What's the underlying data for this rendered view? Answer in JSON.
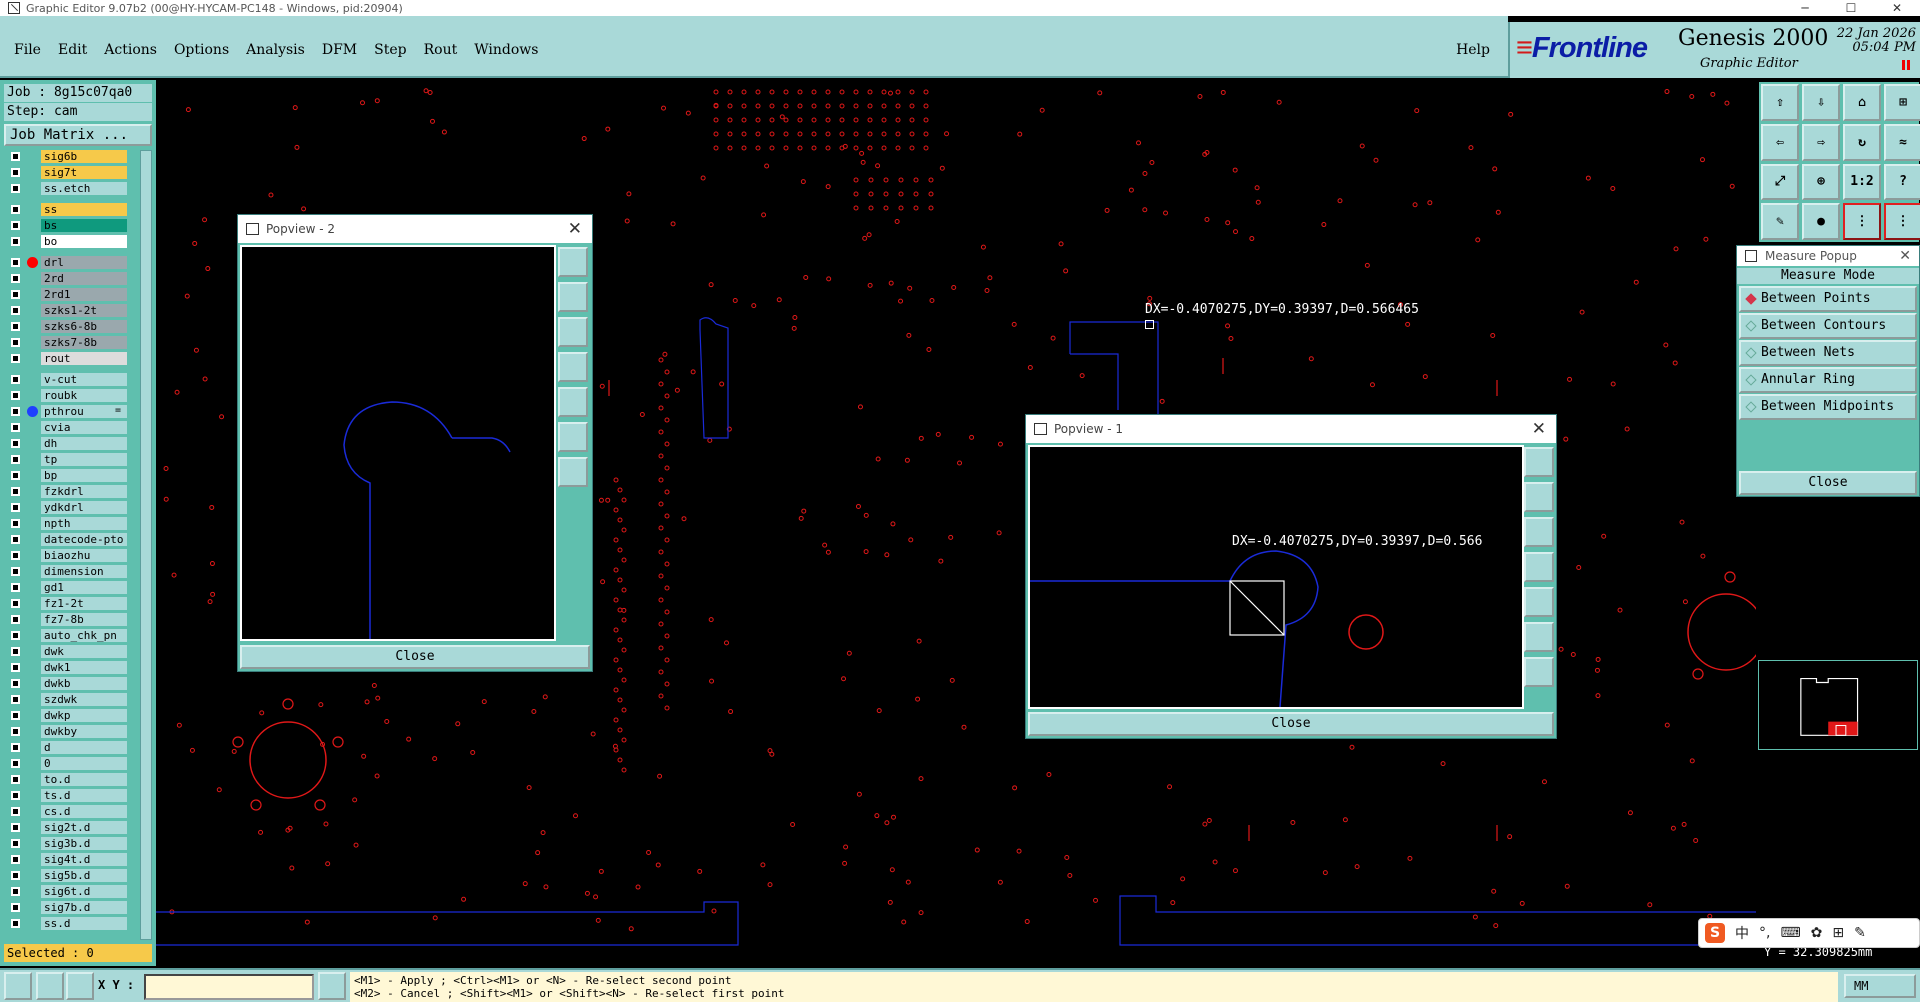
{
  "window": {
    "title": "Graphic Editor 9.07b2 (00@HY-HYCAM-PC148 - Windows, pid:20904)"
  },
  "menu": {
    "items": [
      "File",
      "Edit",
      "Actions",
      "Options",
      "Analysis",
      "DFM",
      "Step",
      "Rout",
      "Windows"
    ],
    "help": "Help"
  },
  "brand": {
    "logo": "Frontline",
    "product": "Genesis 2000",
    "subtitle": "Graphic Editor",
    "date": "22 Jan 2026",
    "time": "05:04 PM"
  },
  "job": {
    "job_label": "Job : 8g15c07qa0",
    "step_label": "Step: cam",
    "matrix_button": "Job Matrix ..."
  },
  "layers": [
    {
      "name": "sig6b",
      "color": "#f6c94a"
    },
    {
      "name": "sig7t",
      "color": "#f6c94a"
    },
    {
      "name": "ss.etch",
      "color": "#a9d9d8"
    },
    {
      "name": "ss",
      "color": "#f6c94a"
    },
    {
      "name": "bs",
      "color": "#0f9a7e"
    },
    {
      "name": "bo",
      "color": "#ffffff"
    },
    {
      "name": "drl",
      "color": "#9aa8ad",
      "active": "#ff0000"
    },
    {
      "name": "2rd",
      "color": "#9aa8ad"
    },
    {
      "name": "2rd1",
      "color": "#9aa8ad"
    },
    {
      "name": "szks1-2t",
      "color": "#9aa8ad"
    },
    {
      "name": "szks6-8b",
      "color": "#9aa8ad"
    },
    {
      "name": "szks7-8b",
      "color": "#9aa8ad"
    },
    {
      "name": "rout",
      "color": "#dcdcdc"
    },
    {
      "name": "v-cut",
      "color": "#a9d9d8"
    },
    {
      "name": "roubk",
      "color": "#a9d9d8"
    },
    {
      "name": "pthrou",
      "color": "#a9d9d8",
      "active": "#1f3fff",
      "mark": "="
    },
    {
      "name": "cvia",
      "color": "#a9d9d8"
    },
    {
      "name": "dh",
      "color": "#a9d9d8"
    },
    {
      "name": "tp",
      "color": "#a9d9d8"
    },
    {
      "name": "bp",
      "color": "#a9d9d8"
    },
    {
      "name": "fzkdrl",
      "color": "#a9d9d8"
    },
    {
      "name": "ydkdrl",
      "color": "#a9d9d8"
    },
    {
      "name": "npth",
      "color": "#a9d9d8"
    },
    {
      "name": "datecode-pto",
      "color": "#a9d9d8"
    },
    {
      "name": "biaozhu",
      "color": "#a9d9d8"
    },
    {
      "name": "dimension",
      "color": "#a9d9d8"
    },
    {
      "name": "gd1",
      "color": "#a9d9d8"
    },
    {
      "name": "fz1-2t",
      "color": "#a9d9d8"
    },
    {
      "name": "fz7-8b",
      "color": "#a9d9d8"
    },
    {
      "name": "auto_chk_pn",
      "color": "#a9d9d8"
    },
    {
      "name": "dwk",
      "color": "#a9d9d8"
    },
    {
      "name": "dwk1",
      "color": "#a9d9d8"
    },
    {
      "name": "dwkb",
      "color": "#a9d9d8"
    },
    {
      "name": "szdwk",
      "color": "#a9d9d8"
    },
    {
      "name": "dwkp",
      "color": "#a9d9d8"
    },
    {
      "name": "dwkby",
      "color": "#a9d9d8"
    },
    {
      "name": "d",
      "color": "#a9d9d8"
    },
    {
      "name": "0",
      "color": "#a9d9d8"
    },
    {
      "name": "to.d",
      "color": "#a9d9d8"
    },
    {
      "name": "ts.d",
      "color": "#a9d9d8"
    },
    {
      "name": "cs.d",
      "color": "#a9d9d8"
    },
    {
      "name": "sig2t.d",
      "color": "#a9d9d8"
    },
    {
      "name": "sig3b.d",
      "color": "#a9d9d8"
    },
    {
      "name": "sig4t.d",
      "color": "#a9d9d8"
    },
    {
      "name": "sig5b.d",
      "color": "#a9d9d8"
    },
    {
      "name": "sig6t.d",
      "color": "#a9d9d8"
    },
    {
      "name": "sig7b.d",
      "color": "#a9d9d8"
    },
    {
      "name": "ss.d",
      "color": "#a9d9d8"
    }
  ],
  "status": {
    "selected": "Selected : 0",
    "y_coord": "Y = 32.309825mm",
    "units": "MM"
  },
  "measurement": {
    "label": "DX=-0.4070275,DY=0.39397,D=0.566465",
    "label_popview": "DX=-0.4070275,DY=0.39397,D=0.566"
  },
  "measure_popup": {
    "title": "Measure Popup",
    "mode_title": "Measure Mode",
    "options": [
      "Between Points",
      "Between Contours",
      "Between Nets",
      "Annular Ring",
      "Between Midpoints"
    ],
    "active_option": 0,
    "close": "Close"
  },
  "popview1": {
    "title": "Popview - 1",
    "close": "Close"
  },
  "popview2": {
    "title": "Popview - 2",
    "close": "Close"
  },
  "bottom": {
    "xy_label": "X Y :",
    "xy_value": "",
    "hint_line1": "<M1> - Apply  ; <Ctrl><M1> or <N> - Re-select second point",
    "hint_line2": "<M2> - Cancel ; <Shift><M1> or <Shift><N> - Re-select first point"
  },
  "ime": {
    "lang": "中",
    "punct": "°,"
  },
  "colors": {
    "panel": "#a9d9d8",
    "panel_dark": "#5fbfae",
    "pad": "#e01818",
    "outline": "#1a2bd8",
    "selected": "#f6c94a"
  }
}
